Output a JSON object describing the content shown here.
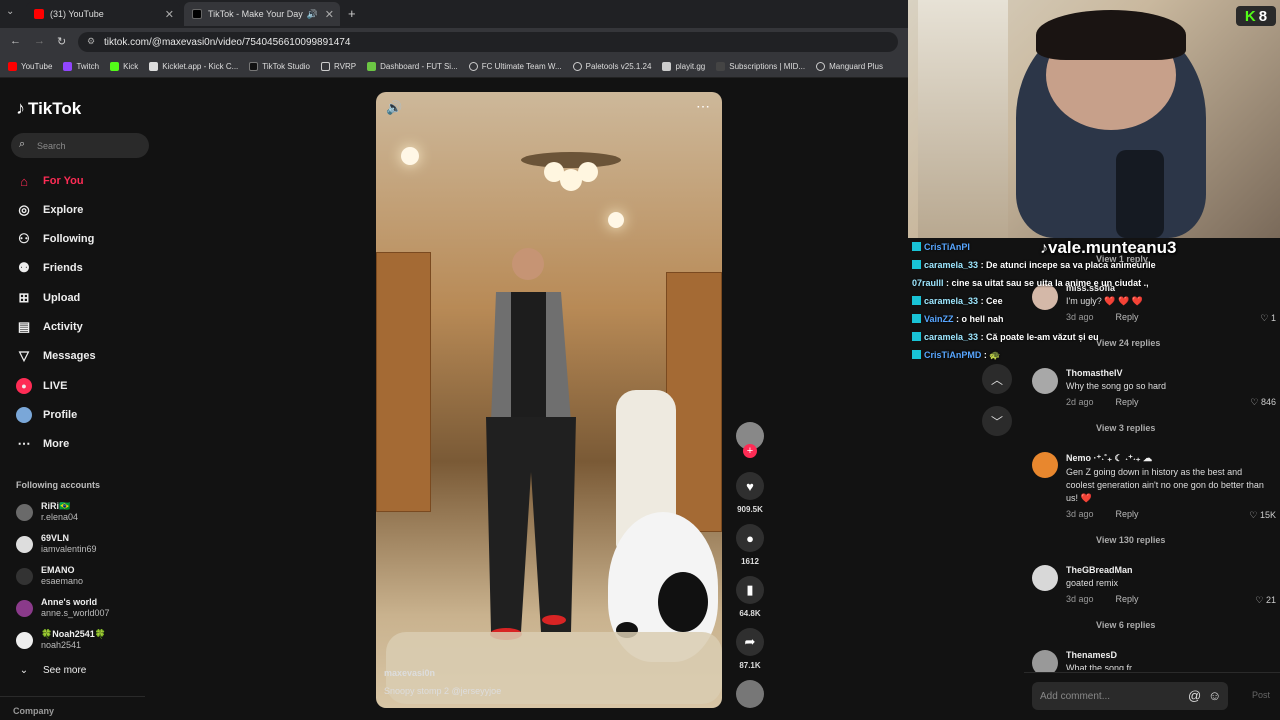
{
  "browser": {
    "tabs": [
      {
        "title": "(31) YouTube"
      },
      {
        "title": "TikTok - Make Your Day"
      }
    ],
    "url": "tiktok.com/@maxevasi0n/video/7540456610099891474",
    "bookmarks": [
      "YouTube",
      "Twitch",
      "Kick",
      "Kicklet.app - Kick C...",
      "TikTok Studio",
      "RVRP",
      "Dashboard - FUT Si...",
      "FC Ultimate Team W...",
      "Paletools v25.1.24",
      "playit.gg",
      "Subscriptions | MID...",
      "Manguard Plus"
    ]
  },
  "sidebar": {
    "logo": "TikTok",
    "search_placeholder": "Search",
    "nav": [
      {
        "label": "For You",
        "icon": "home-icon"
      },
      {
        "label": "Explore",
        "icon": "compass-icon"
      },
      {
        "label": "Following",
        "icon": "following-icon"
      },
      {
        "label": "Friends",
        "icon": "friends-icon"
      },
      {
        "label": "Upload",
        "icon": "upload-icon"
      },
      {
        "label": "Activity",
        "icon": "activity-icon"
      },
      {
        "label": "Messages",
        "icon": "messages-icon"
      },
      {
        "label": "LIVE",
        "icon": "live-icon"
      },
      {
        "label": "Profile",
        "icon": "profile-icon"
      },
      {
        "label": "More",
        "icon": "more-icon"
      }
    ],
    "following_title": "Following accounts",
    "accounts": [
      {
        "name": "RiRi🇧🇷",
        "handle": "r.elena04"
      },
      {
        "name": "69VLN",
        "handle": "iamvalentin69"
      },
      {
        "name": "EMANO",
        "handle": "esaemano"
      },
      {
        "name": "Anne's world",
        "handle": "anne.s_world007"
      },
      {
        "name": "🍀Noah2541🍀",
        "handle": "noah2541"
      }
    ],
    "see_more": "See more",
    "company": "Company"
  },
  "video": {
    "username": "maxevasi0n",
    "caption": "Snoopy stomp 2 @jerseyyjoe",
    "likes": "909.5K",
    "comments": "1612",
    "saves": "64.8K",
    "shares": "87.1K"
  },
  "overlay": {
    "streamer": "vale.munteanu3",
    "kick_count": "8",
    "chat": [
      {
        "user": "CrisTiAnPI",
        "msg": "",
        "style": "u2"
      },
      {
        "user": "caramela_33",
        "msg": " : De atunci incepe sa va placa animeurile",
        "style": "u"
      },
      {
        "user": "07raulll",
        "msg": " : cine sa uitat sau se uita la anime e un ciudat .,",
        "style": "u"
      },
      {
        "user": "caramela_33",
        "msg": " : Cee",
        "style": "u"
      },
      {
        "user": "VainZZ",
        "msg": " : o hell nah",
        "style": "u2"
      },
      {
        "user": "caramela_33",
        "msg": " : Că poate le-am văzut și eu",
        "style": "u"
      },
      {
        "user": "CrisTiAnPMD",
        "msg": " : 🐢",
        "style": "u2"
      }
    ]
  },
  "comments": {
    "items": [
      {
        "user": "miss.ssofia",
        "text": "I'm ugly? ❤️ ❤️ ❤️",
        "time": "3d ago",
        "reply": "Reply",
        "likes": "1",
        "view_replies": "View 24 replies"
      },
      {
        "user": "ThomastheIV",
        "text": "Why the song go so hard",
        "time": "2d ago",
        "reply": "Reply",
        "likes": "846",
        "view_replies": "View 3 replies"
      },
      {
        "user": "Nemo ·⁺˖˚₊ ☾ ˖⁺˖₊ ☁",
        "text": "Gen Z going down in history as the best and coolest generation ain't no one gon do better than us! ❤️",
        "time": "3d ago",
        "reply": "Reply",
        "likes": "15K",
        "view_replies": "View 130 replies"
      },
      {
        "user": "TheGBreadMan",
        "text": "goated remix",
        "time": "3d ago",
        "reply": "Reply",
        "likes": "21",
        "view_replies": "View 6 replies"
      },
      {
        "user": "ThenamesD",
        "text": "What the song fr",
        "time": "",
        "reply": "",
        "likes": "",
        "view_replies": ""
      }
    ],
    "top_replies": "View 1 reply",
    "add_placeholder": "Add comment...",
    "post": "Post"
  }
}
